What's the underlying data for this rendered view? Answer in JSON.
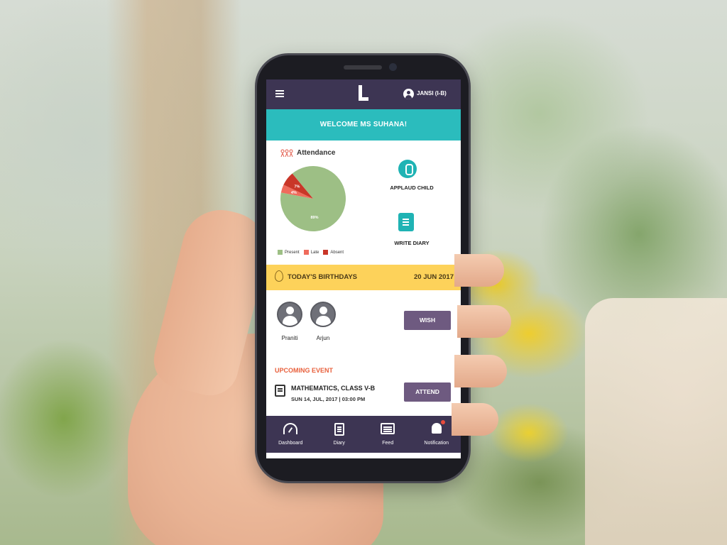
{
  "topbar": {
    "user_label": "JANSI (I-B)"
  },
  "welcome": {
    "text": "WELCOME MS SUHANA!"
  },
  "attendance": {
    "title": "Attendance",
    "slices": [
      {
        "name": "Present",
        "percent": 89,
        "label": "89%",
        "color": "#9dbf85"
      },
      {
        "name": "Late",
        "percent": 4,
        "label": "4%",
        "color": "#ef6b5c"
      },
      {
        "name": "Absent",
        "percent": 7,
        "label": "7%",
        "color": "#c93628"
      }
    ],
    "legend": {
      "present": "Present",
      "late": "Late",
      "absent": "Absent"
    }
  },
  "actions": {
    "applaud_label": "APPLAUD CHILD",
    "diary_label": "WRITE DIARY"
  },
  "birthdays": {
    "title": "TODAY'S BIRTHDAYS",
    "date": "20 JUN 2017",
    "people": [
      "Praniti",
      "Arjun"
    ],
    "wish_label": "WISH"
  },
  "upcoming": {
    "title": "UPCOMING EVENT",
    "event_title": "MATHEMATICS, CLASS V-B",
    "event_time": "SUN 14, JUL, 2017 | 03:00 PM",
    "attend_label": "ATTEND"
  },
  "nav": {
    "dashboard": "Dashboard",
    "diary": "Diary",
    "feed": "Feed",
    "notification": "Notification"
  },
  "colors": {
    "header": "#3d3553",
    "welcome": "#2bbcbd",
    "birthday_bar": "#fdd25a",
    "button": "#6e5a80",
    "accent_teal": "#1fb3b4",
    "upcoming_title": "#e8603c"
  }
}
